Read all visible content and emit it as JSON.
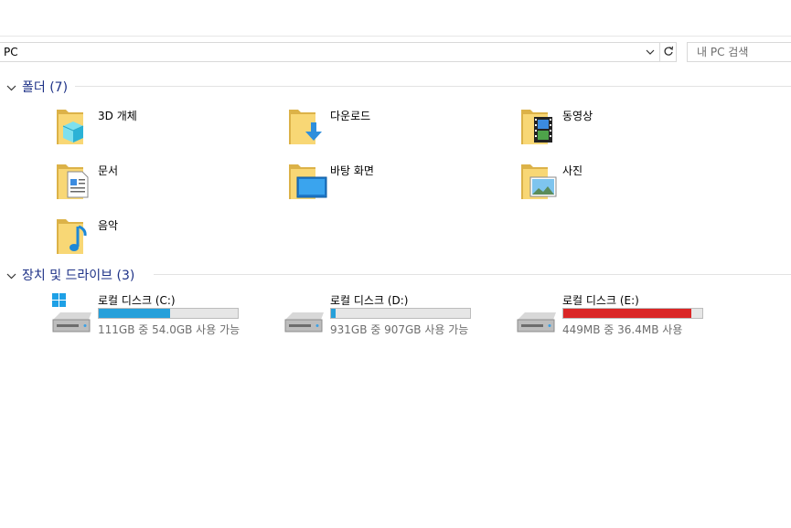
{
  "address": {
    "path": "PC"
  },
  "search": {
    "placeholder": "내 PC 검색"
  },
  "folders_section": {
    "title": "폴더 (7)"
  },
  "folders": [
    {
      "name": "3D 개체",
      "icon": "3d-objects-folder-icon"
    },
    {
      "name": "다운로드",
      "icon": "downloads-folder-icon"
    },
    {
      "name": "동영상",
      "icon": "videos-folder-icon"
    },
    {
      "name": "문서",
      "icon": "documents-folder-icon"
    },
    {
      "name": "바탕 화면",
      "icon": "desktop-folder-icon"
    },
    {
      "name": "사진",
      "icon": "pictures-folder-icon"
    },
    {
      "name": "음악",
      "icon": "music-folder-icon"
    }
  ],
  "drives_section": {
    "title": "장치 및 드라이브 (3)"
  },
  "drives": [
    {
      "name": "로컬 디스크 (C:)",
      "info": "111GB 중 54.0GB 사용 가능",
      "used_fraction": 0.51,
      "bar_color": "#26a0da",
      "icon": "windows-drive-icon"
    },
    {
      "name": "로컬 디스크 (D:)",
      "info": "931GB 중 907GB 사용 가능",
      "used_fraction": 0.03,
      "bar_color": "#26a0da",
      "icon": "hard-drive-icon"
    },
    {
      "name": "로컬 디스크 (E:)",
      "info": "449MB 중 36.4MB 사용",
      "used_fraction": 0.92,
      "bar_color": "#da2626",
      "icon": "hard-drive-icon"
    }
  ]
}
